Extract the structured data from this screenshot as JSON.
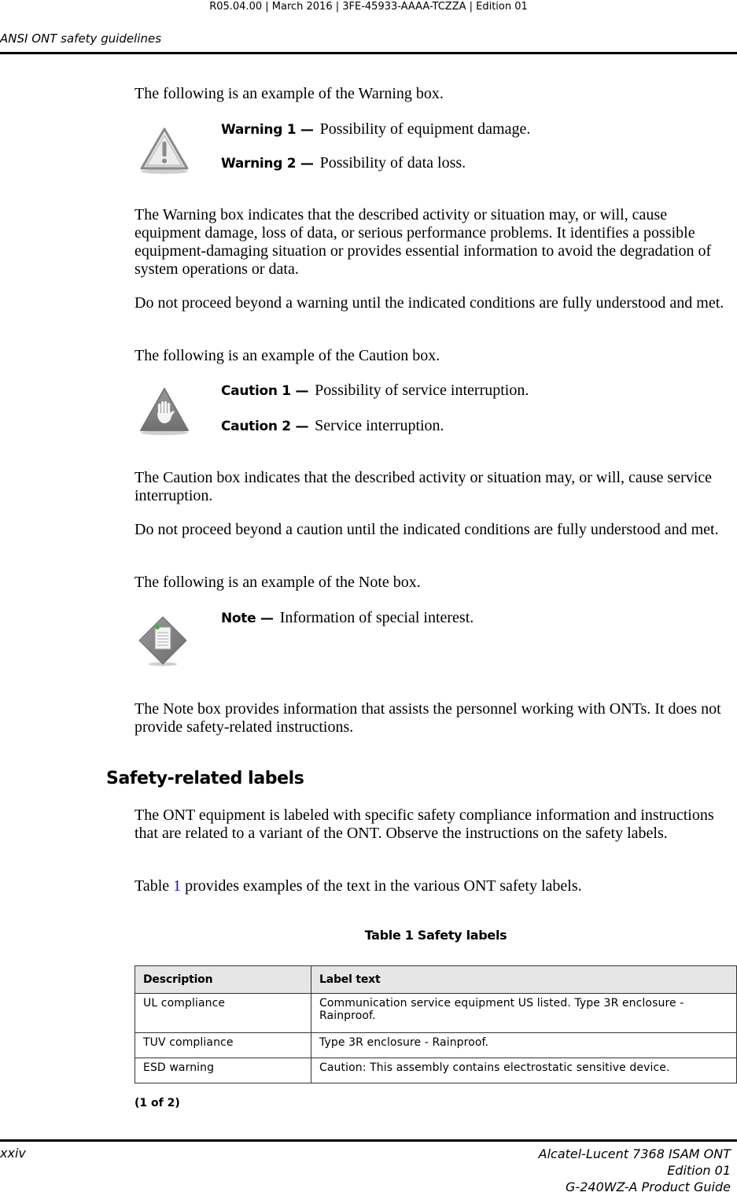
{
  "header": {
    "meta": "R05.04.00 | March 2016 | 3FE-45933-AAAA-TCZZA | Edition 01",
    "running_title": "ANSI ONT safety guidelines"
  },
  "warning_section": {
    "intro": "The following is an example of the Warning box.",
    "icon": "warning-triangle-exclamation-icon",
    "items": [
      {
        "label": "Warning 1 —",
        "text": "Possibility of equipment damage."
      },
      {
        "label": "Warning 2 —",
        "text": "Possibility of data loss."
      }
    ],
    "para1": "The Warning box indicates that the described activity or situation may, or will, cause equipment damage, loss of data, or serious performance problems. It identifies a possible equipment-damaging situation or provides essential information to avoid the degradation of system operations or data.",
    "para2": "Do not proceed beyond a warning until the indicated conditions are fully understood and met."
  },
  "caution_section": {
    "intro": "The following is an example of the Caution box.",
    "icon": "caution-triangle-hand-icon",
    "items": [
      {
        "label": "Caution 1 —",
        "text": "Possibility of service interruption."
      },
      {
        "label": "Caution 2 —",
        "text": "Service interruption."
      }
    ],
    "para1": "The Caution box indicates that the described activity or situation may, or will, cause service interruption.",
    "para2": "Do not proceed beyond a caution until the indicated conditions are fully understood and met."
  },
  "note_section": {
    "intro": "The following is an example of the Note box.",
    "icon": "note-diamond-document-icon",
    "items": [
      {
        "label": "Note —",
        "text": "Information of special interest."
      }
    ],
    "para1": "The Note box provides information that assists the personnel working with ONTs. It does not provide safety-related instructions."
  },
  "safety_labels": {
    "heading": "Safety-related labels",
    "para1": "The ONT equipment is labeled with specific safety compliance information and instructions that are related to a variant of the ONT. Observe the instructions on the safety labels.",
    "para2_prefix": "Table ",
    "para2_link": "1",
    "para2_suffix": " provides examples of the text in the various ONT safety labels.",
    "link_color": "#1a0dab"
  },
  "table": {
    "caption": "Table 1  Safety labels",
    "columns": [
      "Description",
      "Label text"
    ],
    "rows": [
      [
        "UL compliance",
        "Communication service equipment US listed. Type 3R enclosure - Rainproof."
      ],
      [
        "TUV compliance",
        "Type 3R enclosure - Rainproof."
      ],
      [
        "ESD warning",
        "Caution: This assembly contains electrostatic sensitive device."
      ]
    ],
    "continuation": "(1 of 2)",
    "header_bg": "#e6e6e6"
  },
  "footer": {
    "page_number": "xxiv",
    "product_line1": "Alcatel-Lucent 7368 ISAM ONT",
    "product_line2": "Edition 01",
    "product_line3": "G-240WZ-A Product Guide"
  }
}
